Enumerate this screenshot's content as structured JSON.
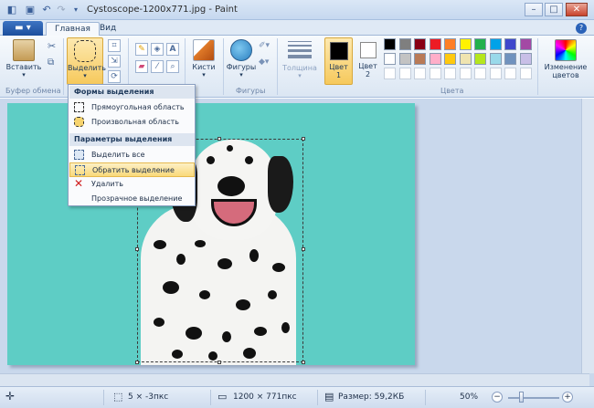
{
  "window": {
    "title": "Cystoscope-1200x771.jpg - Paint",
    "controls": {
      "minimize": "–",
      "maximize": "□",
      "close": "✕"
    }
  },
  "tabs": {
    "file": "▬ ▾",
    "home": "Главная",
    "view": "Вид",
    "help": "?"
  },
  "ribbon": {
    "clipboard": {
      "paste": "Вставить",
      "group": "Буфер обмена"
    },
    "image": {
      "select": "Выделить"
    },
    "tools": {
      "group": "Инструменты"
    },
    "brushes": "Кисти",
    "shapes": {
      "label": "Фигуры",
      "group": "Фигуры"
    },
    "thickness": "Толщина",
    "color1": {
      "label": "Цвет",
      "num": "1"
    },
    "color2": {
      "label": "Цвет",
      "num": "2"
    },
    "colors_group": "Цвета",
    "edit_colors": {
      "line1": "Изменение",
      "line2": "цветов"
    },
    "palette": [
      "#000000",
      "#7f7f7f",
      "#880015",
      "#ed1c24",
      "#ff7f27",
      "#fff200",
      "#22b14c",
      "#00a2e8",
      "#3f48cc",
      "#a349a4",
      "#ffffff",
      "#c3c3c3",
      "#b97a57",
      "#ffaec9",
      "#ffc90e",
      "#efe4b0",
      "#b5e61d",
      "#99d9ea",
      "#7092be",
      "#c8bfe7"
    ]
  },
  "menu": {
    "header_shapes": "Формы выделения",
    "rect": "Прямоугольная область",
    "free": "Произвольная область",
    "header_params": "Параметры выделения",
    "select_all": "Выделить все",
    "invert": "Обратить выделение",
    "delete": "Удалить",
    "transparent": "Прозрачное выделение"
  },
  "status": {
    "selection_size": "5 × -3пкс",
    "image_size": "1200 × 771пкс",
    "file_size": "Размер: 59,2КБ",
    "zoom": "50%",
    "zoom_out": "−",
    "zoom_in": "+",
    "zoom_level": 0.5
  },
  "colors": {
    "canvas": "#5ecdc5",
    "workspace": "#c9d8ec"
  }
}
